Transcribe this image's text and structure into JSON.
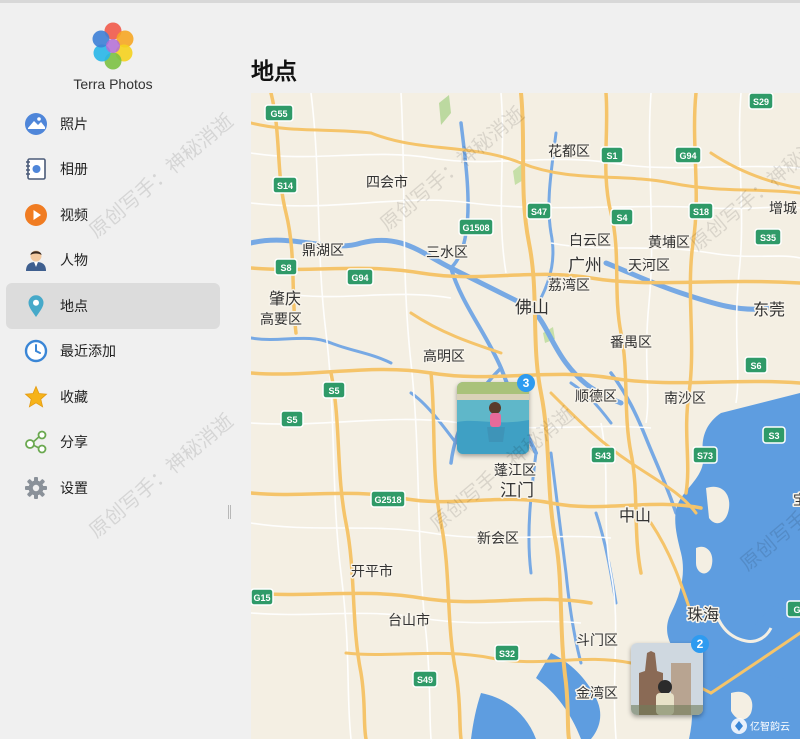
{
  "app": {
    "title": "Terra Photos"
  },
  "colors": {
    "accent": "#2e9bf0",
    "active_bg": "#dcdcdc",
    "water": "#5e9de0",
    "road": "#f5c46a"
  },
  "nav": [
    {
      "id": "photos",
      "label": "照片",
      "icon": "photos-icon",
      "active": false
    },
    {
      "id": "albums",
      "label": "相册",
      "icon": "album-icon",
      "active": false
    },
    {
      "id": "videos",
      "label": "视频",
      "icon": "video-play-icon",
      "active": false
    },
    {
      "id": "people",
      "label": "人物",
      "icon": "person-icon",
      "active": false
    },
    {
      "id": "places",
      "label": "地点",
      "icon": "location-pin-icon",
      "active": true
    },
    {
      "id": "recent",
      "label": "最近添加",
      "icon": "clock-icon",
      "active": false
    },
    {
      "id": "favorites",
      "label": "收藏",
      "icon": "star-icon",
      "active": false
    },
    {
      "id": "share",
      "label": "分享",
      "icon": "share-icon",
      "active": false
    },
    {
      "id": "settings",
      "label": "设置",
      "icon": "gear-icon",
      "active": false
    }
  ],
  "page": {
    "title": "地点"
  },
  "map": {
    "labels": [
      "花都区",
      "四会市",
      "增城",
      "鼎湖区",
      "三水区",
      "白云区",
      "黄埔区",
      "广州",
      "天河区",
      "荔湾区",
      "肇庆",
      "高要区",
      "佛山",
      "东莞",
      "番禺区",
      "高明区",
      "顺德区",
      "南沙区",
      "蓬江区",
      "江门",
      "中山",
      "新会区",
      "开平市",
      "台山市",
      "珠海",
      "斗门区",
      "金湾区",
      "宝"
    ],
    "shields": [
      "G55",
      "S29",
      "S1",
      "G94",
      "S14",
      "S47",
      "S4",
      "S18",
      "G1508",
      "S35",
      "S8",
      "G94",
      "S6",
      "S5",
      "S5",
      "S3",
      "G2518",
      "S43",
      "S73",
      "G15",
      "S32",
      "S49",
      "G"
    ],
    "clusters": [
      {
        "count": "3",
        "subject": "child in swimming pool"
      },
      {
        "count": "2",
        "subject": "person by pagoda"
      }
    ],
    "watermark": "原创写手：神秘消逝",
    "brand": "亿智韵云"
  }
}
